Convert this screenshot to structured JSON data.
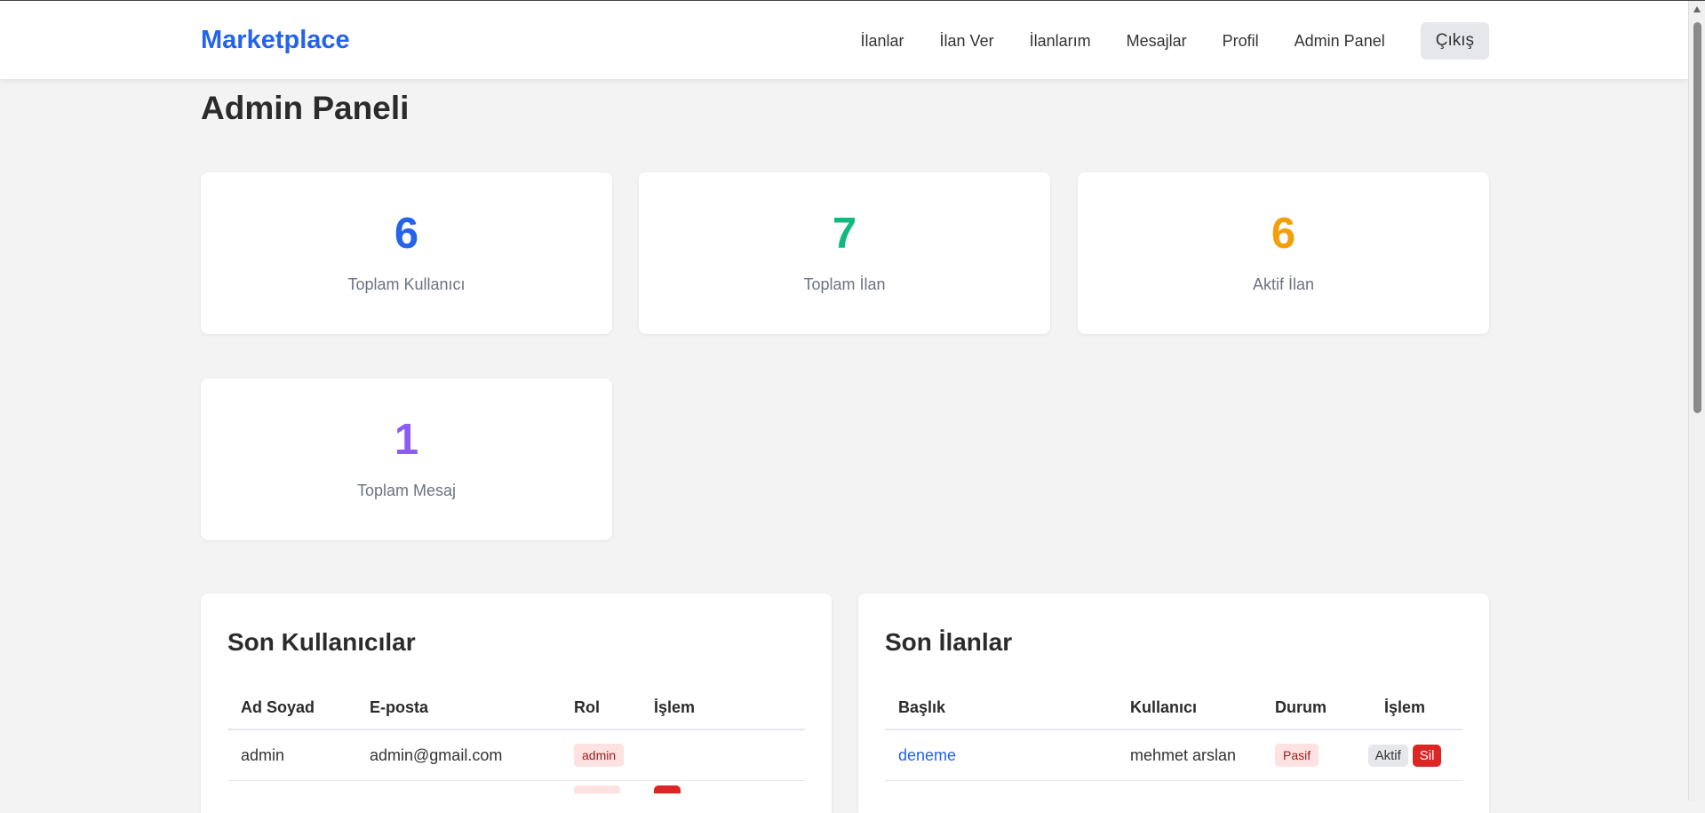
{
  "navbar": {
    "brand": "Marketplace",
    "links": [
      "İlanlar",
      "İlan Ver",
      "İlanlarım",
      "Mesajlar",
      "Profil",
      "Admin Panel"
    ],
    "logout": "Çıkış"
  },
  "page_title": "Admin Paneli",
  "stats": [
    {
      "value": "6",
      "label": "Toplam Kullanıcı",
      "color": "#2563eb"
    },
    {
      "value": "7",
      "label": "Toplam İlan",
      "color": "#10b981"
    },
    {
      "value": "6",
      "label": "Aktif İlan",
      "color": "#f59e0b"
    },
    {
      "value": "1",
      "label": "Toplam Mesaj",
      "color": "#8b5cf6"
    }
  ],
  "recent_users": {
    "title": "Son Kullanıcılar",
    "columns": [
      "Ad Soyad",
      "E-posta",
      "Rol",
      "İşlem"
    ],
    "rows": [
      {
        "name": "admin",
        "email": "admin@gmail.com",
        "role": "admin"
      }
    ]
  },
  "recent_listings": {
    "title": "Son İlanlar",
    "columns": [
      "Başlık",
      "Kullanıcı",
      "Durum",
      "İşlem"
    ],
    "rows": [
      {
        "title": "deneme",
        "user": "mehmet arslan",
        "status": "Pasif",
        "action_toggle": "Aktif",
        "action_delete": "Sil"
      }
    ]
  }
}
